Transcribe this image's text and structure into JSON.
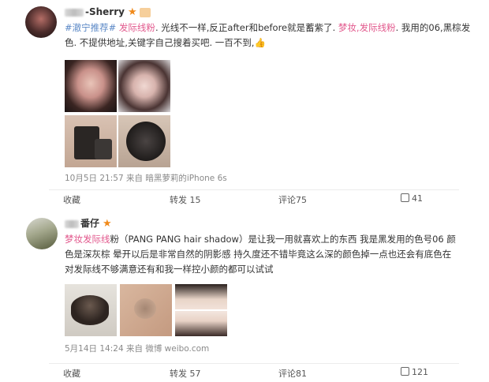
{
  "posts": [
    {
      "user": {
        "name_visible": "-Sherry"
      },
      "text_segments": {
        "tag1": "#澈宁推荐#",
        "hl1": " 发际线粉",
        "plain1": ". 光线不一样,反正after和before就是蓄紫了.",
        "hl2": " 梦妆,发际线粉",
        "plain2": ". 我用的06,黑棕发",
        "line2": "色. 不提供地址,关键字自己搜着买吧. 一百不到,"
      },
      "meta": "10月5日 21:57 来自 暗黑萝莉的iPhone 6s",
      "actions": {
        "collect": "收藏",
        "repost": "转发 15",
        "comment": "评论75",
        "like": "41"
      }
    },
    {
      "user": {
        "name_visible": "番仔"
      },
      "text_segments": {
        "hl1": "梦妆发际线",
        "plain1": "粉（PANG PANG hair shadow）是让我一用就喜欢上的东西 我是黑发用的色号06 颜",
        "line2": "色是深灰棕 晕开以后是非常自然的阴影感 持久度还不错毕竟这么深的颜色掉一点也还会有底色在",
        "line3": "对发际线不够满意还有和我一样控小颜的都可以试试"
      },
      "meta": "5月14日 14:24 来自 微博 weibo.com",
      "actions": {
        "collect": "收藏",
        "repost": "转发 57",
        "comment": "评论81",
        "like": "121"
      }
    }
  ],
  "icons": {
    "star": "star-icon",
    "vip": "vip-badge-icon",
    "like": "thumbs-up-icon",
    "emoji": "thumbs-up-emoji-icon"
  },
  "colors": {
    "highlight": "#e2598d",
    "tag": "#5b88c6",
    "star": "#f08a1b"
  }
}
